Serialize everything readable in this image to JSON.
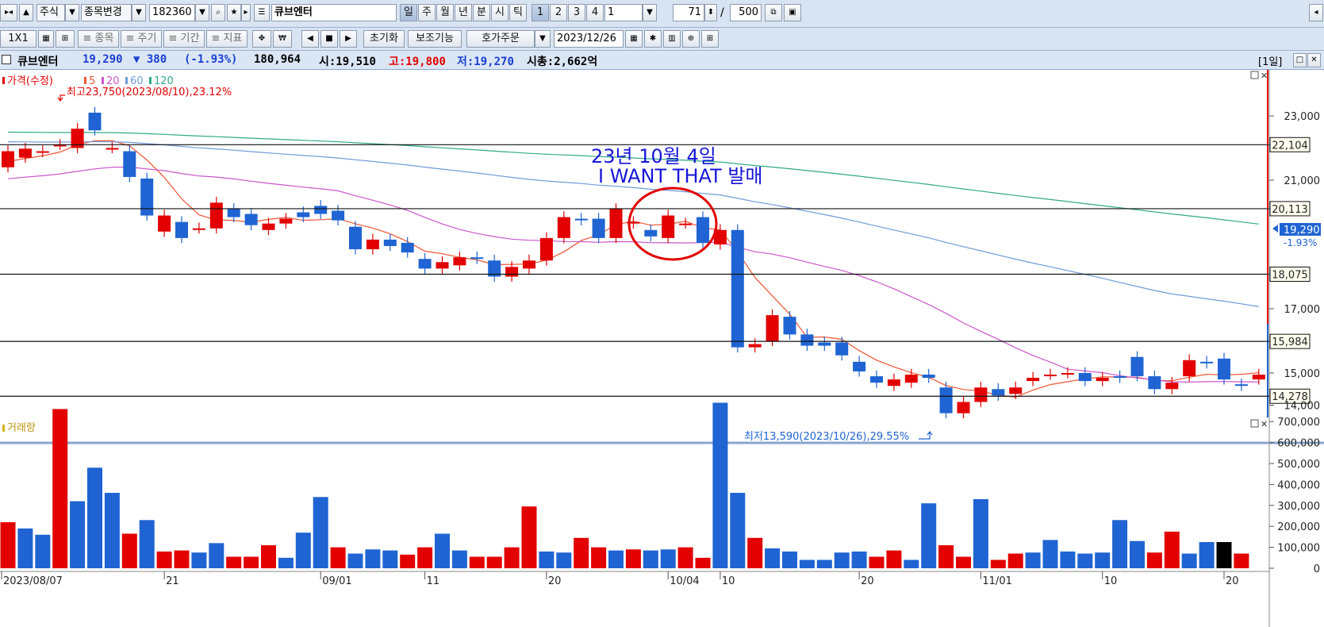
{
  "toolbar": {
    "market": "주식",
    "change_stock": "종목변경",
    "code": "182360",
    "stock_name": "큐브엔터",
    "periods": [
      "일",
      "주",
      "월",
      "년",
      "분",
      "시",
      "틱"
    ],
    "intervals": [
      "1",
      "2",
      "3",
      "4"
    ],
    "interval_value": "1",
    "count": "71",
    "total": "500",
    "layout": "1X1",
    "tools": [
      "종목",
      "주기",
      "기간",
      "지표"
    ],
    "reset": "초기화",
    "aux": "보조기능",
    "order": "호가주문",
    "date": "2023/12/26"
  },
  "info": {
    "name": "큐브엔터",
    "price": "19,290",
    "change": "▼ 380",
    "pct": "(-1.93%)",
    "volume": "180,964",
    "open": "시:19,510",
    "high": "고:19,800",
    "low": "저:19,270",
    "cap": "시총:2,662억",
    "period": "[1일]"
  },
  "legend": {
    "price": "가격(수정)",
    "ma5": "5",
    "ma20": "20",
    "ma60": "60",
    "ma120": "120",
    "volume": "거래량"
  },
  "annotations": {
    "high": "최고23,750(2023/08/10),23.12%",
    "low": "최저13,590(2023/10/26),29.55%",
    "note1": "23년 10월 4일",
    "note2": "I WANT THAT 발매"
  },
  "price_labels": {
    "current": "19,290",
    "current_pct": "-1.93%",
    "hlines": [
      "22,104",
      "20,113",
      "18,075",
      "15,984",
      "14,278"
    ]
  },
  "colors": {
    "up": "#e20000",
    "down": "#1f64d2",
    "ma5": "#ee5533",
    "ma20": "#cc55cc",
    "ma60": "#6f9cd8",
    "ma120": "#33aa88"
  },
  "chart_data": [
    {
      "type": "candlestick",
      "y_ticks": [
        23000,
        21000,
        17000,
        15000,
        14000
      ],
      "ylim": [
        13300,
        24500
      ],
      "x_labels": [
        "2023/08/07",
        "21",
        "09/01",
        "11",
        "20",
        "10/04",
        "10",
        "20",
        "11/01",
        "10",
        "20"
      ],
      "horizontal_lines": [
        22104,
        20113,
        18075,
        15984,
        14278
      ],
      "candles": [
        {
          "o": 21400,
          "c": 21900
        },
        {
          "o": 21700,
          "c": 21980
        },
        {
          "o": 21880,
          "c": 21900
        },
        {
          "o": 22100,
          "c": 22100
        },
        {
          "o": 22000,
          "c": 22600
        },
        {
          "o": 23100,
          "c": 22550
        },
        {
          "o": 22000,
          "c": 22000
        },
        {
          "o": 21900,
          "c": 21100
        },
        {
          "o": 21050,
          "c": 19900
        },
        {
          "o": 19400,
          "c": 19900
        },
        {
          "o": 19700,
          "c": 19200
        },
        {
          "o": 19500,
          "c": 19500
        },
        {
          "o": 19500,
          "c": 20300
        },
        {
          "o": 20100,
          "c": 19850
        },
        {
          "o": 19950,
          "c": 19600
        },
        {
          "o": 19450,
          "c": 19650
        },
        {
          "o": 19650,
          "c": 19800
        },
        {
          "o": 20000,
          "c": 19850
        },
        {
          "o": 20200,
          "c": 19950
        },
        {
          "o": 20050,
          "c": 19750
        },
        {
          "o": 19550,
          "c": 18850
        },
        {
          "o": 18850,
          "c": 19150
        },
        {
          "o": 19150,
          "c": 18950
        },
        {
          "o": 19050,
          "c": 18750
        },
        {
          "o": 18550,
          "c": 18250
        },
        {
          "o": 18250,
          "c": 18450
        },
        {
          "o": 18350,
          "c": 18600
        },
        {
          "o": 18600,
          "c": 18550
        },
        {
          "o": 18500,
          "c": 18000
        },
        {
          "o": 18000,
          "c": 18300
        },
        {
          "o": 18250,
          "c": 18500
        },
        {
          "o": 18500,
          "c": 19200
        },
        {
          "o": 19200,
          "c": 19850
        },
        {
          "o": 19800,
          "c": 19750
        },
        {
          "o": 19800,
          "c": 19200
        },
        {
          "o": 19200,
          "c": 20100
        },
        {
          "o": 19650,
          "c": 19700
        },
        {
          "o": 19450,
          "c": 19250
        },
        {
          "o": 19200,
          "c": 19900
        },
        {
          "o": 19650,
          "c": 19650
        },
        {
          "o": 19850,
          "c": 19050
        },
        {
          "o": 19000,
          "c": 19450
        },
        {
          "o": 19450,
          "c": 15800
        },
        {
          "o": 15800,
          "c": 15900
        },
        {
          "o": 16000,
          "c": 16800
        },
        {
          "o": 16750,
          "c": 16200
        },
        {
          "o": 16200,
          "c": 15850
        },
        {
          "o": 15950,
          "c": 15850
        },
        {
          "o": 15950,
          "c": 15550
        },
        {
          "o": 15350,
          "c": 15050
        },
        {
          "o": 14900,
          "c": 14700
        },
        {
          "o": 14600,
          "c": 14800
        },
        {
          "o": 14700,
          "c": 14950
        },
        {
          "o": 14950,
          "c": 14850
        },
        {
          "o": 14550,
          "c": 13750
        },
        {
          "o": 13750,
          "c": 14100
        },
        {
          "o": 14100,
          "c": 14550
        },
        {
          "o": 14500,
          "c": 14300
        },
        {
          "o": 14350,
          "c": 14550
        },
        {
          "o": 14750,
          "c": 14850
        },
        {
          "o": 14950,
          "c": 14950
        },
        {
          "o": 15000,
          "c": 15000
        },
        {
          "o": 15000,
          "c": 14750
        },
        {
          "o": 14750,
          "c": 14850
        },
        {
          "o": 14900,
          "c": 14850
        },
        {
          "o": 15500,
          "c": 14900
        },
        {
          "o": 14900,
          "c": 14500
        },
        {
          "o": 14500,
          "c": 14700
        },
        {
          "o": 14900,
          "c": 15400
        },
        {
          "o": 15350,
          "c": 15300
        },
        {
          "o": 15450,
          "c": 14800
        },
        {
          "o": 14650,
          "c": 14600
        },
        {
          "o": 14800,
          "c": 14950
        }
      ]
    },
    {
      "type": "bar",
      "title": "거래량",
      "y_ticks": [
        700000,
        600000,
        500000,
        400000,
        300000,
        200000,
        100000,
        0
      ],
      "ylim": [
        0,
        850000
      ],
      "values": [
        220000,
        190000,
        160000,
        760000,
        320000,
        480000,
        360000,
        165000,
        230000,
        80000,
        85000,
        75000,
        120000,
        55000,
        55000,
        110000,
        50000,
        170000,
        340000,
        100000,
        70000,
        90000,
        85000,
        65000,
        100000,
        165000,
        85000,
        55000,
        55000,
        100000,
        295000,
        80000,
        75000,
        145000,
        100000,
        85000,
        90000,
        85000,
        90000,
        100000,
        50000,
        790000,
        360000,
        145000,
        95000,
        80000,
        40000,
        40000,
        75000,
        80000,
        55000,
        85000,
        40000,
        310000,
        110000,
        55000,
        330000,
        40000,
        70000,
        75000,
        135000,
        80000,
        70000,
        75000,
        230000,
        130000,
        75000,
        175000,
        70000,
        125000,
        125000,
        70000
      ],
      "colors": [
        "up",
        "down",
        "down",
        "up",
        "down",
        "down",
        "down",
        "up",
        "down",
        "up",
        "up",
        "down",
        "down",
        "up",
        "up",
        "up",
        "down",
        "down",
        "down",
        "up",
        "down",
        "down",
        "down",
        "up",
        "up",
        "down",
        "down",
        "up",
        "up",
        "up",
        "up",
        "down",
        "down",
        "up",
        "up",
        "down",
        "up",
        "down",
        "down",
        "up",
        "up",
        "down",
        "down",
        "up",
        "down",
        "down",
        "down",
        "down",
        "down",
        "down",
        "up",
        "up",
        "down",
        "down",
        "up",
        "up",
        "down",
        "up",
        "up",
        "down",
        "down",
        "down",
        "down",
        "down",
        "down",
        "down",
        "up",
        "up",
        "down",
        "down",
        "black",
        "up"
      ]
    }
  ]
}
